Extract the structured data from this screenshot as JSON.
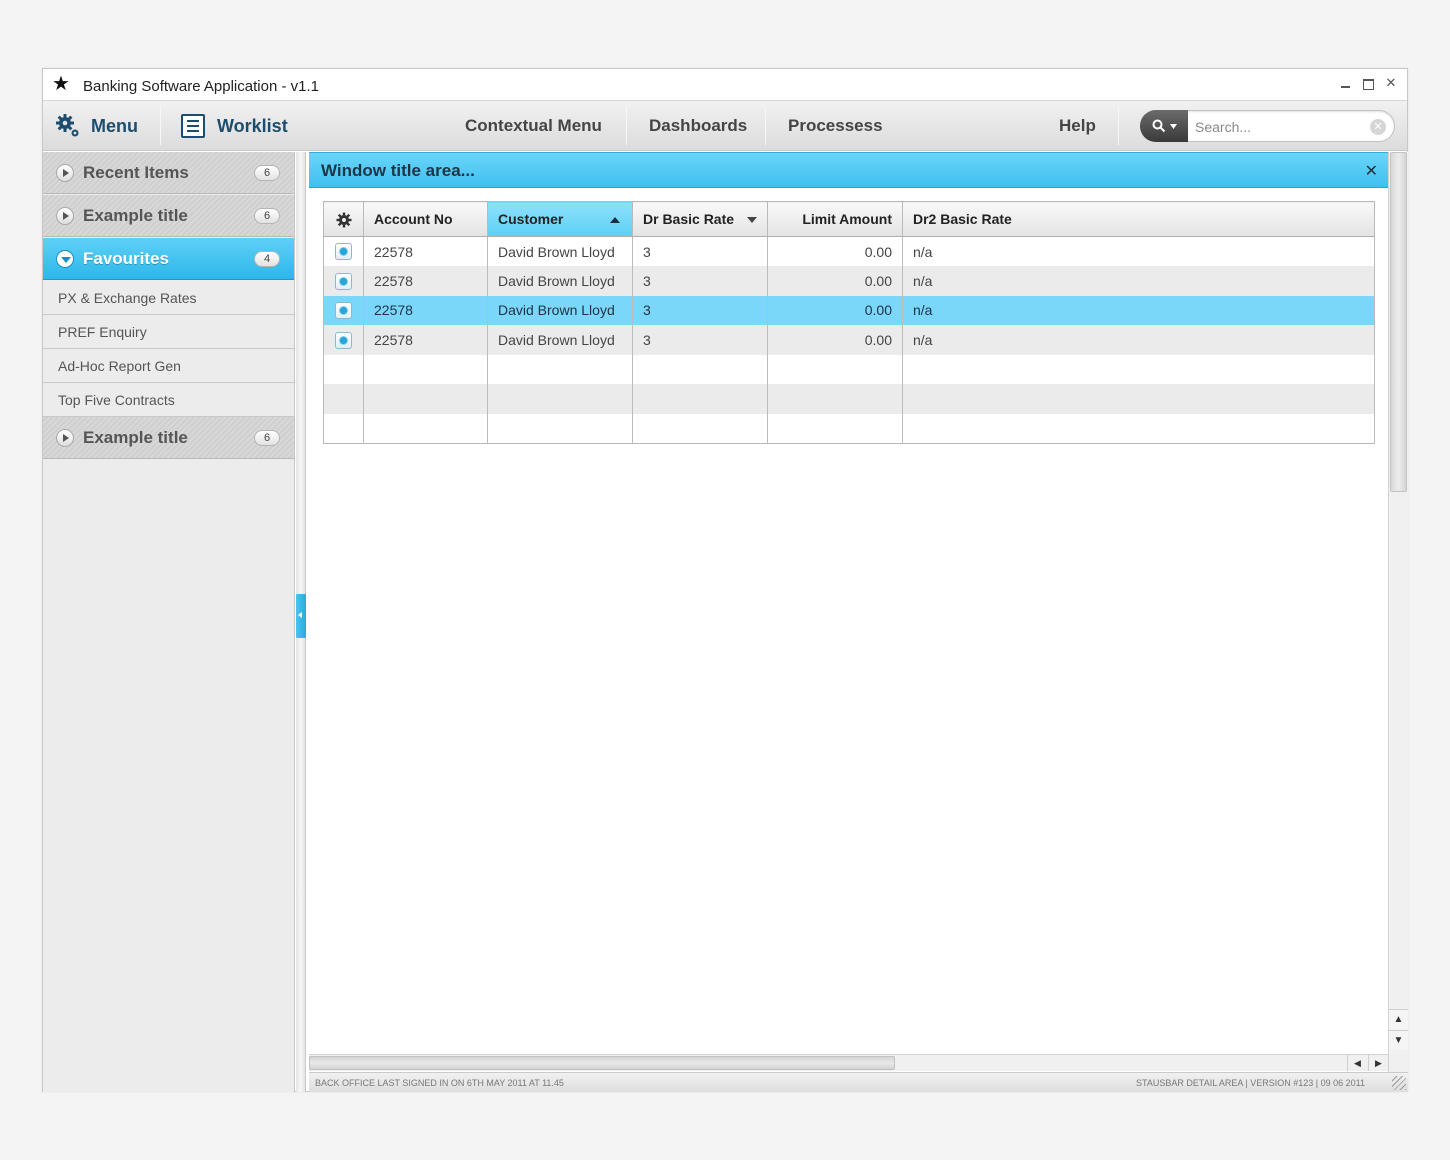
{
  "window": {
    "title": "Banking Software Application - v1.1",
    "controls": {
      "minimize": "",
      "maximize": "",
      "close": "✕"
    }
  },
  "toolbar": {
    "menu_label": "Menu",
    "worklist_label": "Worklist",
    "nav": [
      "Contextual Menu",
      "Dashboards",
      "Processess",
      "Help"
    ],
    "search_placeholder": "Search...",
    "search_value": ""
  },
  "sidebar": {
    "sections": [
      {
        "label": "Recent Items",
        "count": "6",
        "expanded": false
      },
      {
        "label": "Example title",
        "count": "6",
        "expanded": false
      },
      {
        "label": "Favourites",
        "count": "4",
        "expanded": true,
        "items": [
          "PX & Exchange Rates",
          "PREF Enquiry",
          "Ad-Hoc Report Gen",
          "Top Five Contracts"
        ]
      },
      {
        "label": "Example title",
        "count": "6",
        "expanded": false
      }
    ]
  },
  "main": {
    "window_title": "Window title area...",
    "close_label": "✕"
  },
  "grid": {
    "columns": [
      "Account No",
      "Customer",
      "Dr Basic Rate",
      "Limit Amount",
      "Dr2 Basic Rate"
    ],
    "sorted_column": "Customer",
    "rows": [
      [
        "22578",
        "David Brown Lloyd",
        "3",
        "0.00",
        "n/a"
      ],
      [
        "22578",
        "David Brown Lloyd",
        "3",
        "0.00",
        "n/a"
      ],
      [
        "22578",
        "David Brown Lloyd",
        "3",
        "0.00",
        "n/a"
      ],
      [
        "22578",
        "David Brown Lloyd",
        "3",
        "0.00",
        "n/a"
      ],
      [
        "",
        "",
        "",
        "",
        ""
      ],
      [
        "",
        "",
        "",
        "",
        ""
      ],
      [
        "",
        "",
        "",
        "",
        ""
      ]
    ],
    "selected_row": 3
  },
  "statusbar": {
    "left": "BACK OFFICE LAST SIGNED IN ON 6TH MAY 2011 AT 11.45",
    "right": "STAUSBAR DETAIL AREA | VERSION #123 | 09 06 2011"
  },
  "colors": {
    "accent": "#3fc0ef",
    "selected_row": "#7ad7fa",
    "brand_text": "#1d4d6e"
  },
  "icons": {
    "app": "star-icon",
    "menu": "gear-icon",
    "worklist": "list-icon",
    "search": "magnifier-icon",
    "row_action": "row-settings-icon"
  }
}
